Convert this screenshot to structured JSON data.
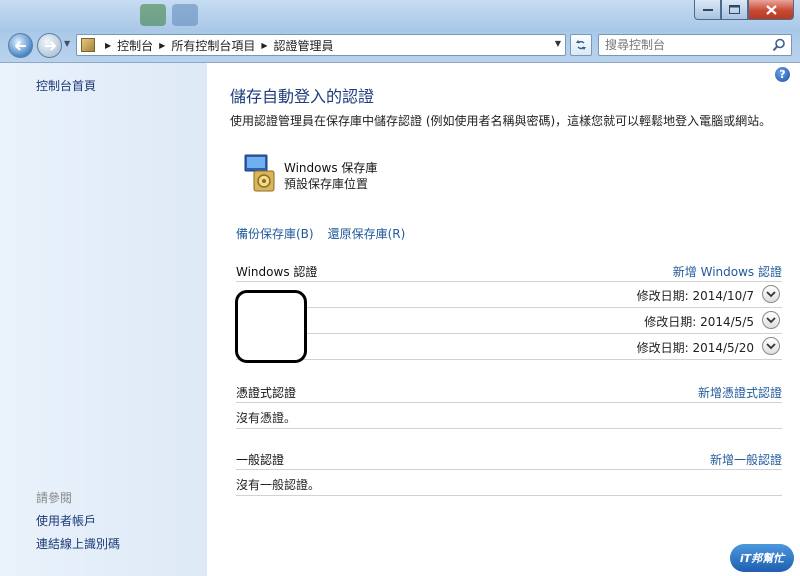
{
  "address_bar": {
    "crumbs": [
      "控制台",
      "所有控制台項目",
      "認證管理員"
    ]
  },
  "search": {
    "placeholder": "搜尋控制台"
  },
  "left_pane": {
    "home": "控制台首頁",
    "see_also": "請參閱",
    "links": [
      "使用者帳戶",
      "連結線上識別碼"
    ]
  },
  "main": {
    "heading": "儲存自動登入的認證",
    "description": "使用認證管理員在保存庫中儲存認證 (例如使用者名稱與密碼)，這樣您就可以輕鬆地登入電腦或網站。",
    "vault": {
      "name": "Windows 保存庫",
      "subtitle": "預設保存庫位置"
    },
    "backup_link": "備份保存庫(B)",
    "restore_link": "還原保存庫(R)",
    "windows_credentials": {
      "title": "Windows 認證",
      "add_label": "新增 Windows 認證",
      "items": [
        {
          "date": "修改日期: 2014/10/7"
        },
        {
          "date": "修改日期: 2014/5/5"
        },
        {
          "date": "修改日期: 2014/5/20"
        }
      ]
    },
    "certificate_credentials": {
      "title": "憑證式認證",
      "add_label": "新增憑證式認證",
      "empty": "沒有憑證。"
    },
    "generic_credentials": {
      "title": "一般認證",
      "add_label": "新增一般認證",
      "empty": "沒有一般認證。"
    }
  },
  "watermark": "iT邦幫忙",
  "icons": {
    "back": "back-arrow-icon",
    "forward": "forward-arrow-icon",
    "refresh": "refresh-icon",
    "search": "search-icon",
    "help": "help-icon",
    "vault": "vault-icon",
    "expand": "chevron-down-icon"
  },
  "colors": {
    "link": "#1f5a9b",
    "heading": "#1e3d7a",
    "left_pane": "#e3edf9",
    "close_button": "#c94a34"
  }
}
